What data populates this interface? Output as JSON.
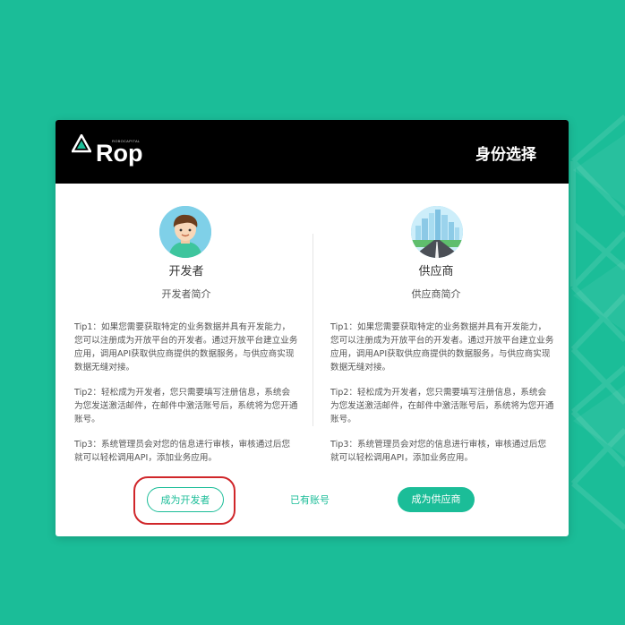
{
  "brand": {
    "logo_text": "Rop",
    "logo_subtext": "ROBOCAPITAL",
    "colors": {
      "accent": "#1bbd98",
      "header": "#000000",
      "highlight": "#d0262a"
    }
  },
  "header": {
    "title": "身份选择"
  },
  "developer": {
    "avatar_icon": "developer-avatar-icon",
    "name": "开发者",
    "intro": "开发者简介",
    "tips": [
      "Tip1：如果您需要获取特定的业务数据并具有开发能力，您可以注册成为开放平台的开发者。通过开放平台建立业务应用，调用API获取供应商提供的数据服务，与供应商实现数据无缝对接。",
      "Tip2：轻松成为开发者，您只需要填写注册信息，系统会为您发送激活邮件，在邮件中激活账号后，系统将为您开通账号。",
      "Tip3：系统管理员会对您的信息进行审核，审核通过后您就可以轻松调用API，添加业务应用。"
    ],
    "button_label": "成为开发者"
  },
  "supplier": {
    "avatar_icon": "city-road-avatar-icon",
    "name": "供应商",
    "intro": "供应商简介",
    "tips": [
      "Tip1：如果您需要获取特定的业务数据并具有开发能力，您可以注册成为开放平台的开发者。通过开放平台建立业务应用，调用API获取供应商提供的数据服务，与供应商实现数据无缝对接。",
      "Tip2：轻松成为开发者，您只需要填写注册信息，系统会为您发送激活邮件，在邮件中激活账号后，系统将为您开通账号。",
      "Tip3：系统管理员会对您的信息进行审核，审核通过后您就可以轻松调用API，添加业务应用。"
    ],
    "button_label": "成为供应商"
  },
  "footer": {
    "existing_account_label": "已有账号"
  }
}
